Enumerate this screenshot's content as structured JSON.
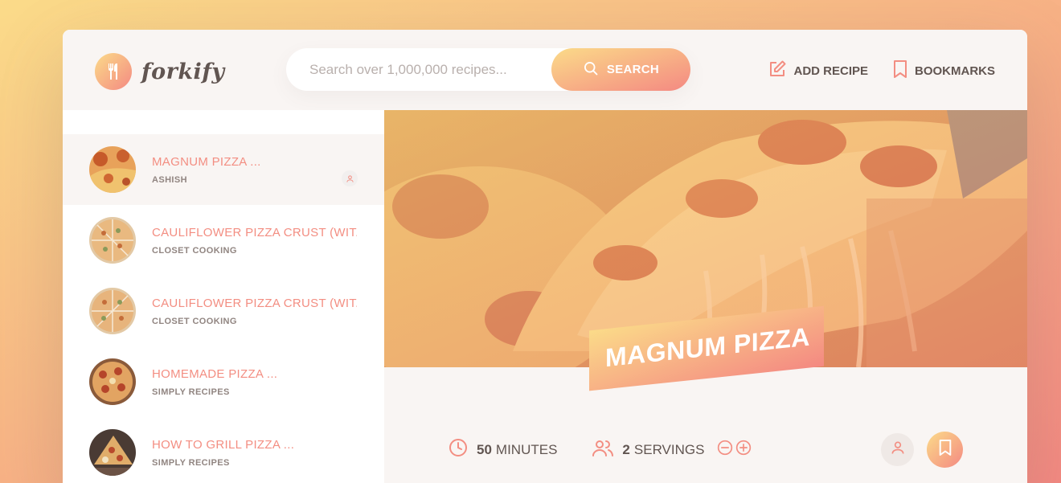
{
  "app": {
    "name": "forkify"
  },
  "search": {
    "placeholder": "Search over 1,000,000 recipes...",
    "button_label": "SEARCH"
  },
  "nav": {
    "add_recipe": "ADD RECIPE",
    "bookmarks": "BOOKMARKS"
  },
  "results": [
    {
      "title": "MAGNUM PIZZA ...",
      "publisher": "ASHISH",
      "active": true,
      "user_generated": true
    },
    {
      "title": "CAULIFLOWER PIZZA CRUST (WIT...",
      "publisher": "CLOSET COOKING",
      "active": false
    },
    {
      "title": "CAULIFLOWER PIZZA CRUST (WIT...",
      "publisher": "CLOSET COOKING",
      "active": false
    },
    {
      "title": "HOMEMADE PIZZA ...",
      "publisher": "SIMPLY RECIPES",
      "active": false
    },
    {
      "title": "HOW TO GRILL PIZZA ...",
      "publisher": "SIMPLY RECIPES",
      "active": false
    }
  ],
  "recipe": {
    "title": "MAGNUM PIZZA",
    "minutes": "50",
    "minutes_label": "MINUTES",
    "servings": "2",
    "servings_label": "SERVINGS"
  },
  "icons": {
    "logo": "fork-knife-icon",
    "search": "search-icon",
    "add_recipe": "edit-icon",
    "bookmarks": "bookmark-icon",
    "clock": "clock-icon",
    "users": "users-icon",
    "minus": "minus-circle-icon",
    "plus": "plus-circle-icon",
    "user": "user-icon"
  },
  "colors": {
    "accent_start": "#fbdb89",
    "accent_end": "#f48982",
    "text": "#615551",
    "title": "#f38e82"
  }
}
